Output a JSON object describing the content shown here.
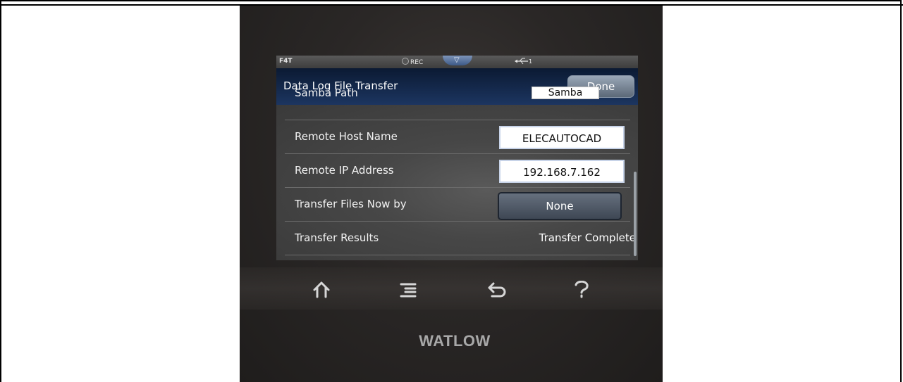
{
  "status_bar": {
    "model": "F4T",
    "rec_label": "REC",
    "usb_label": "←‸• 1"
  },
  "title_bar": {
    "title": "Data Log File Transfer",
    "done_label": "Done"
  },
  "rows": [
    {
      "label": "Samba Path",
      "value": "Samba",
      "kind": "field-partial"
    },
    {
      "label": "Remote Host Name",
      "value": "ELECAUTOCAD",
      "kind": "text-field"
    },
    {
      "label": "Remote IP Address",
      "value": "192.168.7.162",
      "kind": "text-field"
    },
    {
      "label": "Transfer Files Now by",
      "value": "None",
      "kind": "select-button"
    },
    {
      "label": "Transfer Results",
      "value": "Transfer Complete",
      "kind": "readout"
    }
  ],
  "nav_keys": {
    "home": "⌂",
    "menu": "≣",
    "back": "⮌",
    "help": "?"
  },
  "brand": "WATLOW",
  "colors": {
    "title_bar": "#1c3560",
    "device_body": "#2a2726",
    "rows_bg": "#474747"
  }
}
